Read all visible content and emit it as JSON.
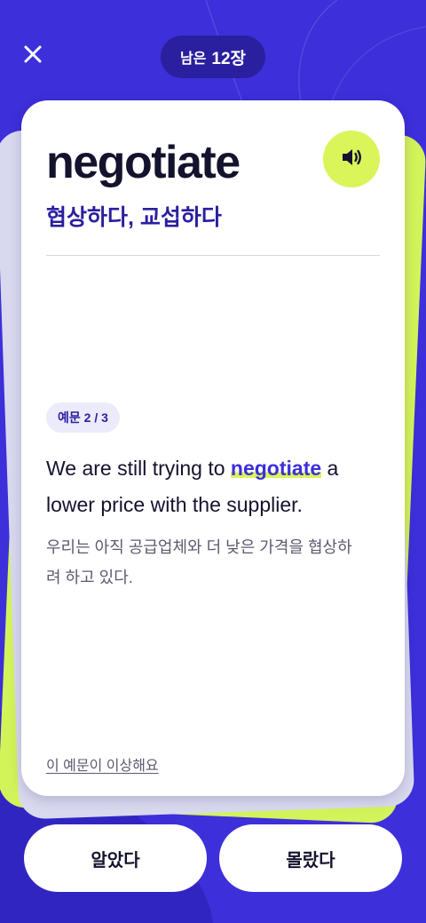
{
  "header": {
    "remaining_label": "남은",
    "remaining_count": "12장"
  },
  "card": {
    "word": "negotiate",
    "meaning": "협상하다, 교섭하다",
    "example_badge": "예문 2 / 3",
    "sentence_before": "We are still trying to ",
    "sentence_highlight": "negotiate",
    "sentence_after": " a lower price with the supplier.",
    "translation": "우리는 아직 공급업체와 더 낮은 가격을 협상하려 하고 있다.",
    "report_link": "이 예문이 이상해요"
  },
  "actions": {
    "known_label": "알았다",
    "unknown_label": "몰랐다"
  },
  "icons": {
    "close": "close-icon",
    "speaker": "speaker-icon"
  },
  "colors": {
    "background": "#3d2fd9",
    "accent_lime": "#d9f55a",
    "badge_dark": "#2a1f9e",
    "text_dark": "#14132e"
  }
}
